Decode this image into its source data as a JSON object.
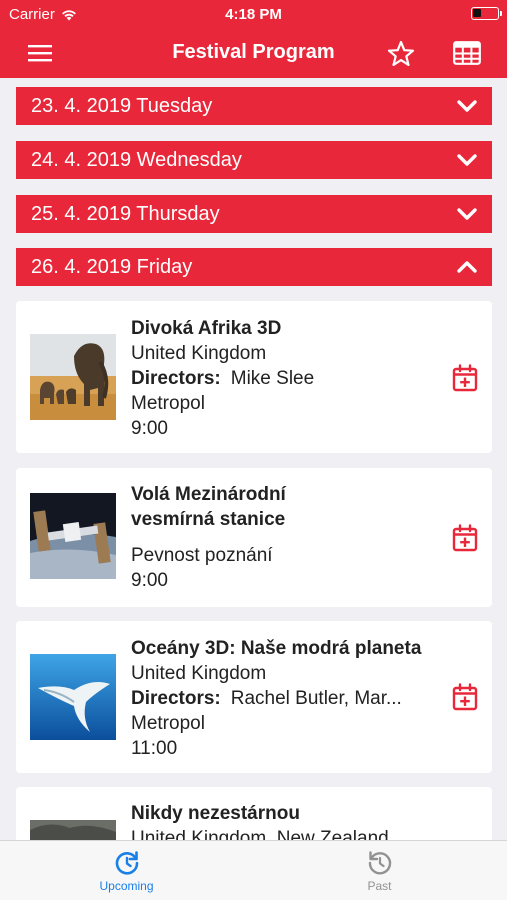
{
  "status_bar": {
    "carrier": "Carrier",
    "time": "4:18 PM",
    "battery_level": 0.3
  },
  "nav": {
    "title": "Festival Program",
    "menu_icon": "hamburger-menu-icon",
    "favorites_icon": "star-icon",
    "schedule_icon": "grid-table-icon"
  },
  "days": [
    {
      "label": "23. 4. 2019 Tuesday",
      "expanded": false
    },
    {
      "label": "24. 4. 2019 Wednesday",
      "expanded": false
    },
    {
      "label": "25. 4. 2019 Thursday",
      "expanded": false
    },
    {
      "label": "26. 4. 2019 Friday",
      "expanded": true
    }
  ],
  "events": [
    {
      "title": "Divoká Afrika 3D",
      "country": "United Kingdom",
      "directors_label": "Directors:",
      "directors": "Mike Slee",
      "venue": "Metropol",
      "time": "9:00"
    },
    {
      "title_line1": "Volá Mezinárodní",
      "title_line2": "vesmírná stanice",
      "venue": "Pevnost poznání",
      "time": "9:00"
    },
    {
      "title": "Oceány 3D: Naše modrá planeta",
      "country": "United Kingdom",
      "directors_label": "Directors:",
      "directors": "Rachel Butler, Mar...",
      "venue": "Metropol",
      "time": "11:00"
    },
    {
      "title": "Nikdy nezestárnou",
      "country": "United Kingdom, New Zealand"
    }
  ],
  "tabs": [
    {
      "label": "Upcoming",
      "icon": "refresh-clock-icon",
      "active": true
    },
    {
      "label": "Past",
      "icon": "history-icon",
      "active": false
    }
  ],
  "colors": {
    "accent": "#e8283a",
    "tab_active": "#1a7fe6",
    "tab_inactive": "#929292"
  }
}
